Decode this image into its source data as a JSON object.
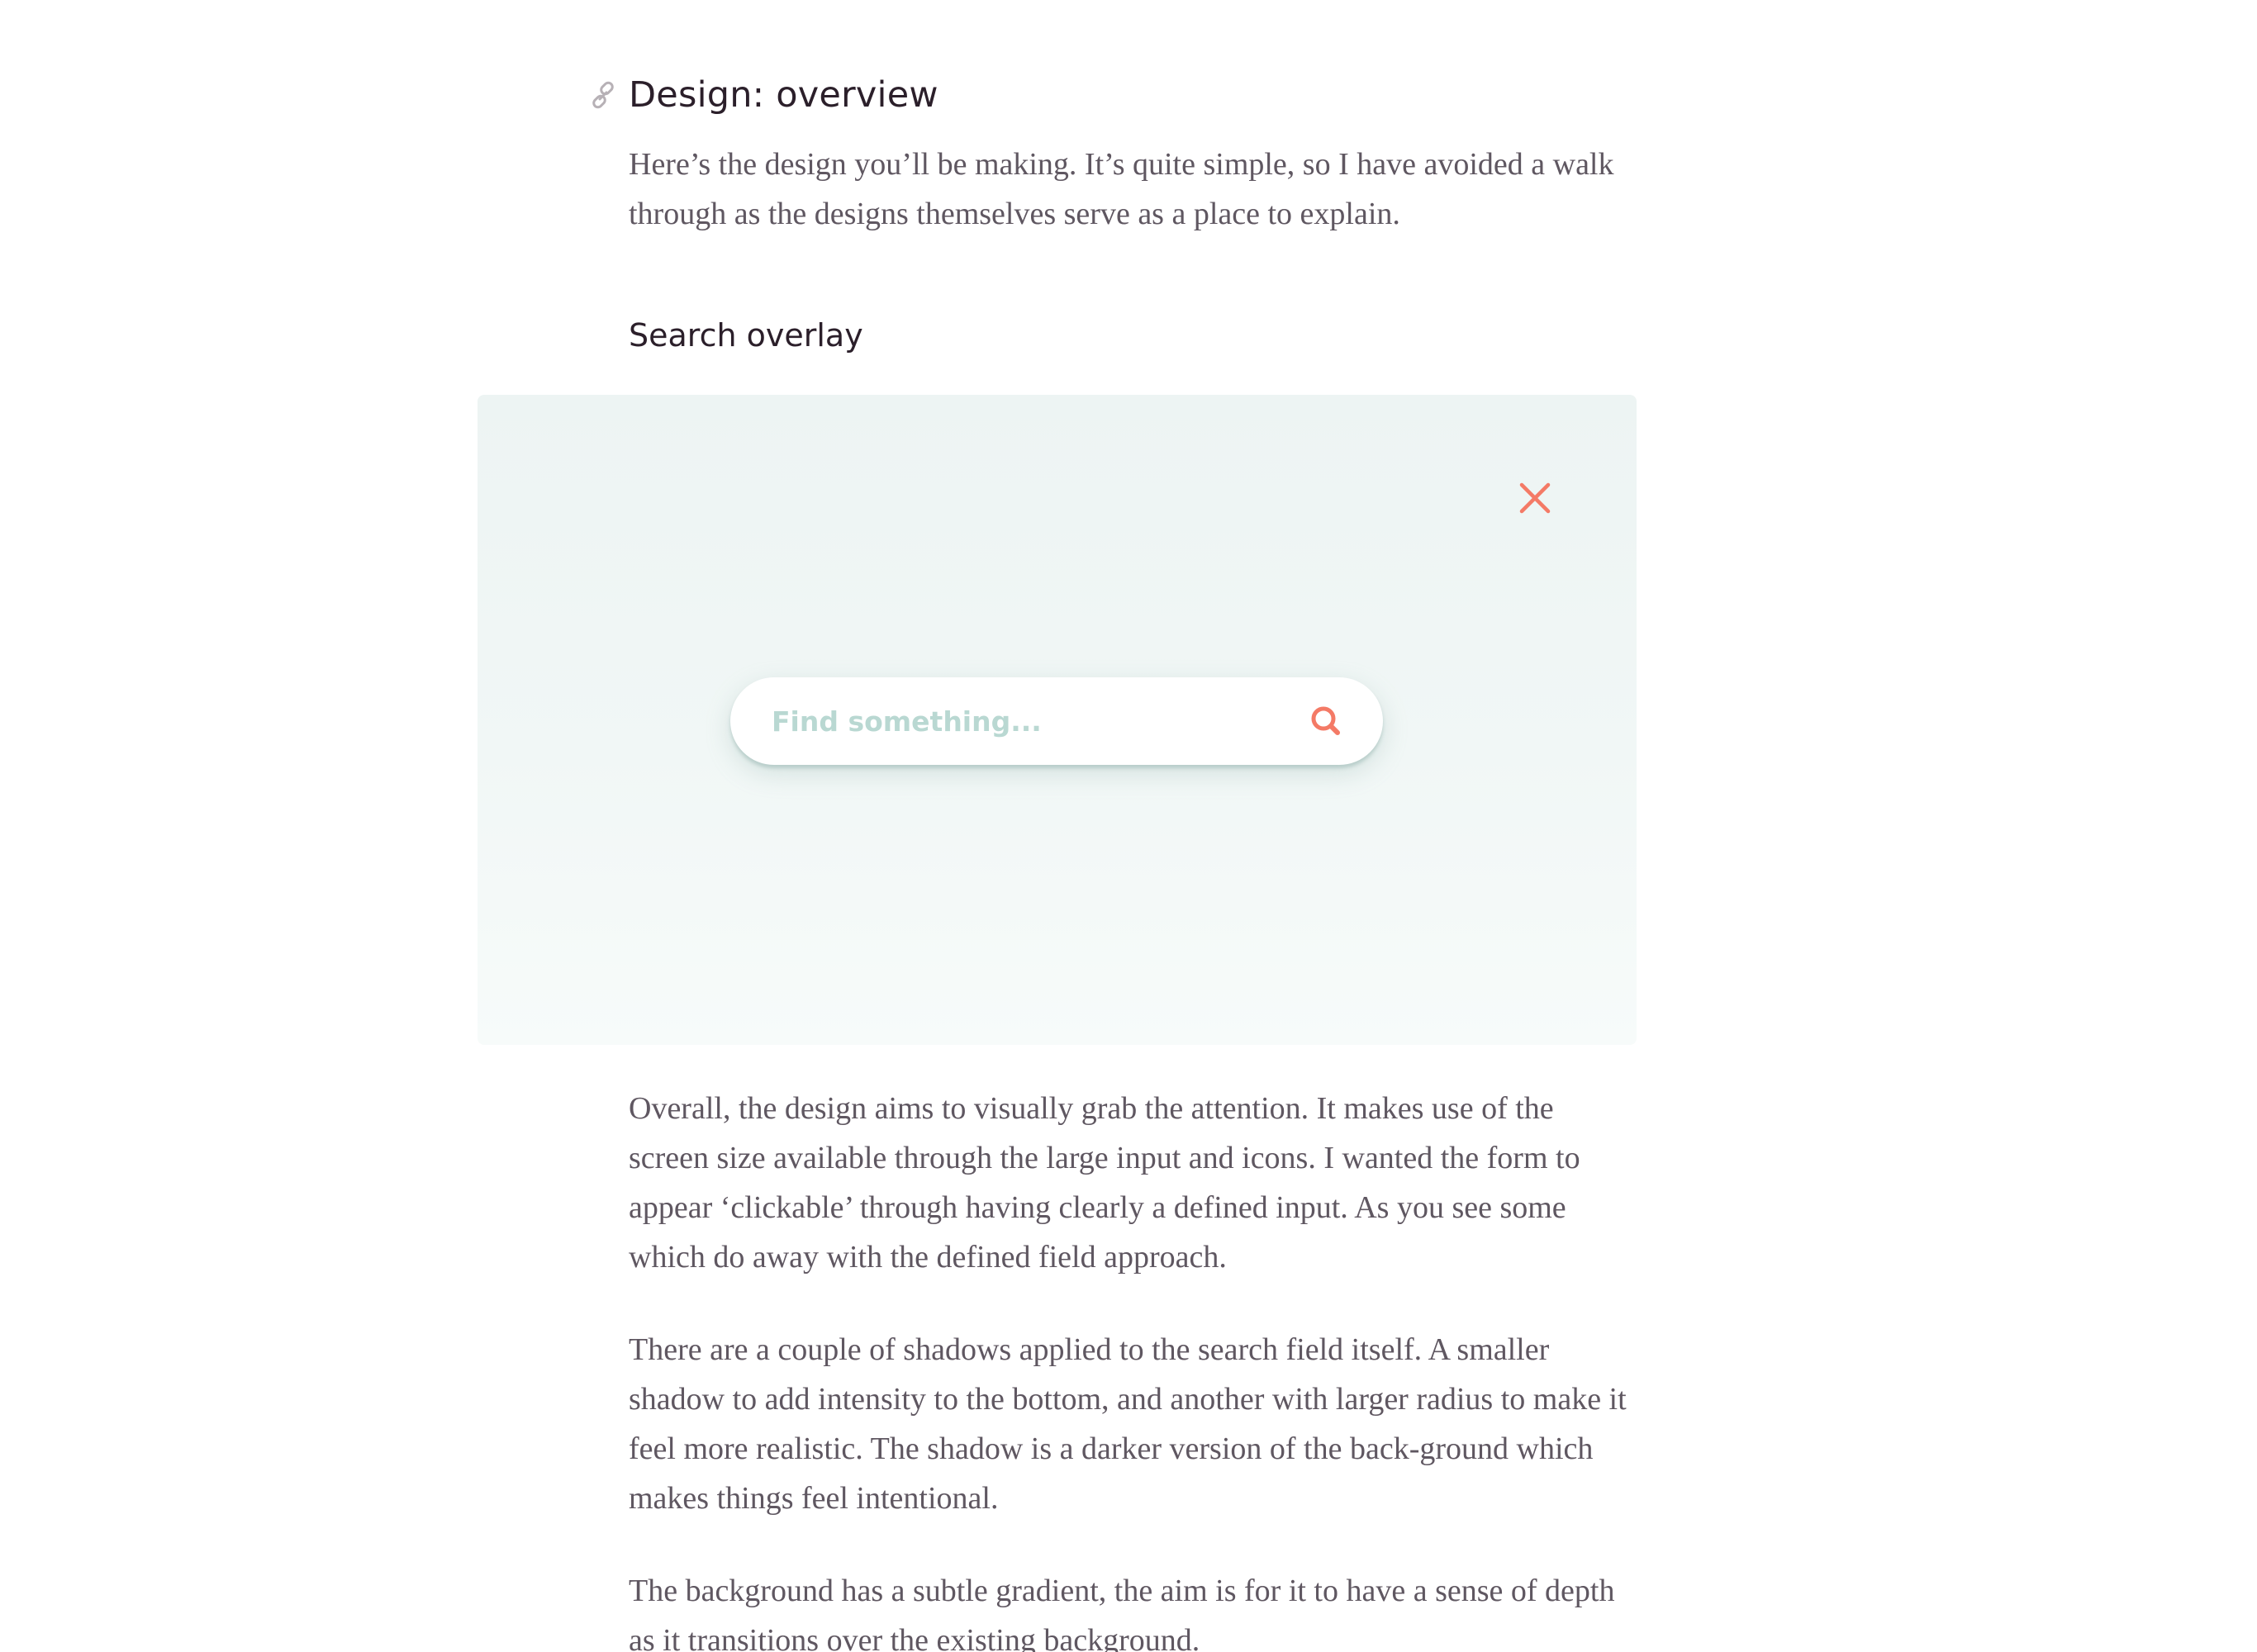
{
  "article": {
    "heading": "Design: overview",
    "intro": "Here’s the design you’ll be making. It’s quite simple, so I have avoided a walk through as the designs themselves serve as a place to explain.",
    "subheading": "Search overlay",
    "figure": {
      "search_placeholder": "Find something...",
      "close_icon": "close-x",
      "search_icon": "magnifier",
      "accent_color": "#f47a66"
    },
    "paragraphs": [
      "Overall, the design aims to visually grab the attention. It makes use of the screen size available through the large input and icons. I wanted the form to appear ‘clickable’ through having clearly a defined input. As you see some which do away with the defined field approach.",
      "There are a couple of shadows applied to the search field itself. A smaller shadow to add intensity to the bottom, and another with larger radius to make it feel more realistic. The shadow is a darker version of the back-ground which makes things feel intentional.",
      "The background has a subtle gradient, the aim is for it to have a sense of depth as it transitions over the existing background."
    ]
  }
}
